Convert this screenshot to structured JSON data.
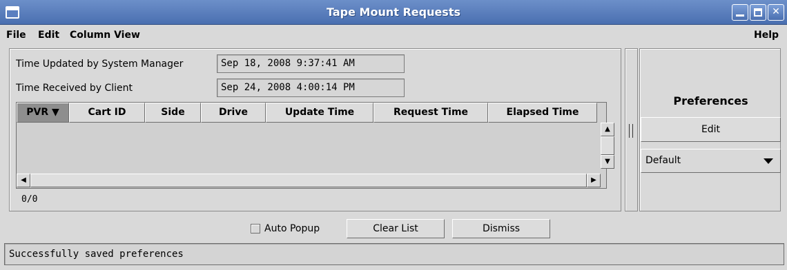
{
  "window": {
    "title": "Tape Mount Requests"
  },
  "menu": {
    "file": "File",
    "edit": "Edit",
    "column_view": "Column View",
    "help": "Help"
  },
  "timestamps": {
    "updated_label": "Time Updated by System Manager",
    "updated_value": "Sep 18, 2008 9:37:41 AM",
    "received_label": "Time Received by Client",
    "received_value": "Sep 24, 2008 4:00:14 PM"
  },
  "table": {
    "columns": [
      {
        "label": "PVR ▼",
        "sorted": true
      },
      {
        "label": "Cart ID",
        "sorted": false
      },
      {
        "label": "Side",
        "sorted": false
      },
      {
        "label": "Drive",
        "sorted": false
      },
      {
        "label": "Update Time",
        "sorted": false
      },
      {
        "label": "Request Time",
        "sorted": false
      },
      {
        "label": "Elapsed Time",
        "sorted": false
      }
    ],
    "rows": [],
    "count": "0/0"
  },
  "preferences": {
    "title": "Preferences",
    "edit_label": "Edit",
    "selected": "Default"
  },
  "actions": {
    "auto_popup_label": "Auto Popup",
    "auto_popup_checked": false,
    "clear_label": "Clear List",
    "dismiss_label": "Dismiss"
  },
  "status": {
    "message": "Successfully saved preferences"
  },
  "icons": {
    "window_menu": "window-menu-icon",
    "minimize": "minimize-icon",
    "maximize": "maximize-icon",
    "close": "close-icon",
    "sort_desc": "sort-descending-icon",
    "scroll_up": "scroll-up-icon",
    "scroll_down": "scroll-down-icon",
    "scroll_left": "scroll-left-icon",
    "scroll_right": "scroll-right-icon",
    "dropdown": "chevron-down-icon"
  },
  "colors": {
    "titlebar": "#4a6fb0",
    "background": "#d9d9d9",
    "sorted_column": "#8e8e8e"
  }
}
